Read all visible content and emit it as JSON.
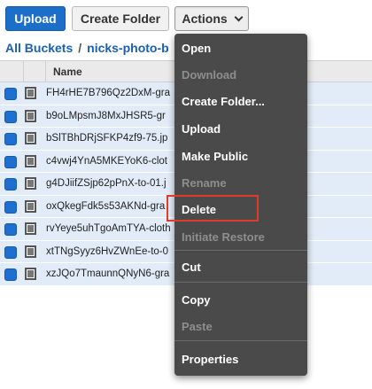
{
  "toolbar": {
    "upload_label": "Upload",
    "create_folder_label": "Create Folder",
    "actions_label": "Actions"
  },
  "breadcrumb": {
    "root": "All Buckets",
    "separator": "/",
    "bucket": "nicks-photo-b"
  },
  "table": {
    "column_name": "Name",
    "rows": [
      "FH4rHE7B796Qz2DxM-gra",
      "b9oLMpsmJ8MxJHSR5-gr",
      "bSlTBhDRjSFKP4zf9-75.jp",
      "c4vwj4YnA5MKEYoK6-clot",
      "g4DJiifZSjp62pPnX-to-01.j",
      "oxQkegFdk5s53AKNd-gra",
      "rvYeye5uhTgoAmTYA-cloth",
      "xtTNgSyyz6HvZWnEe-to-0",
      "xzJQo7TmaunnQNyN6-gra"
    ]
  },
  "menu": {
    "items": [
      {
        "label": "Open",
        "enabled": true
      },
      {
        "label": "Download",
        "enabled": false
      },
      {
        "label": "Create Folder...",
        "enabled": true
      },
      {
        "label": "Upload",
        "enabled": true
      },
      {
        "label": "Make Public",
        "enabled": true
      },
      {
        "label": "Rename",
        "enabled": false
      },
      {
        "label": "Delete",
        "enabled": true
      },
      {
        "label": "Initiate Restore",
        "enabled": false
      },
      {
        "label": "Cut",
        "enabled": true
      },
      {
        "label": "Copy",
        "enabled": true
      },
      {
        "label": "Paste",
        "enabled": false
      },
      {
        "label": "Properties",
        "enabled": true
      }
    ],
    "highlighted_item": "Delete"
  },
  "colors": {
    "primary_button": "#1b6fc9",
    "menu_background": "#4a4a4a",
    "highlight_outline": "#e23b2a",
    "row_selected": "#e2ecf8"
  }
}
